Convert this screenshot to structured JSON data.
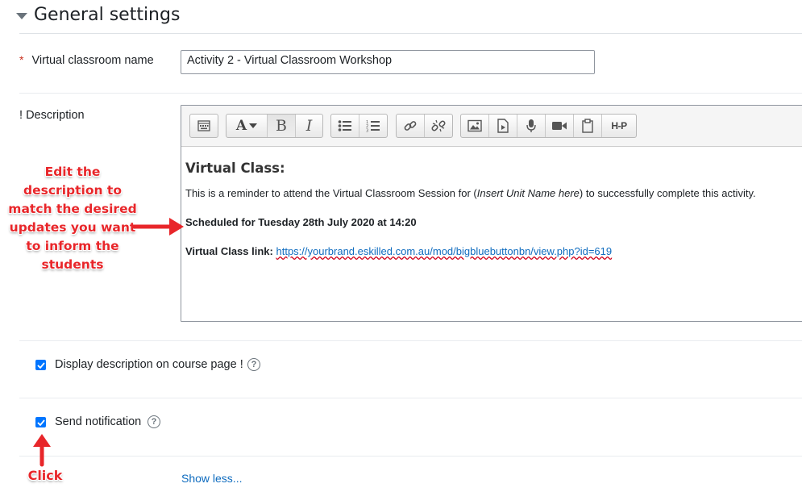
{
  "section": {
    "title": "General settings"
  },
  "fields": {
    "name": {
      "required_marker": "*",
      "label": "Virtual classroom name",
      "value": "Activity 2 - Virtual Classroom Workshop"
    },
    "description": {
      "label_prefix": "!",
      "label": "Description"
    }
  },
  "editor": {
    "heading": "Virtual Class:",
    "line1_before": "This is a reminder to attend the Virtual Classroom Session for (",
    "line1_italic": "Insert Unit Name here",
    "line1_after": ") to successfully complete this activity.",
    "scheduled": "Scheduled for Tuesday 28th July 2020 at 14:20",
    "link_label": "Virtual Class link:",
    "link_url": "https://yourbrand.eskilled.com.au/mod/bigbluebuttonbn/view.php?id=619",
    "toolbar": {
      "font_label": "A",
      "bold_label": "B",
      "italic_label": "I",
      "h5p_label": "H-P"
    }
  },
  "checkboxes": {
    "display_description": {
      "label": "Display description on course page",
      "suffix": "!",
      "checked": true
    },
    "send_notification": {
      "label": "Send notification",
      "checked": true
    }
  },
  "show_less": "Show less...",
  "annotations": {
    "edit_note": "Edit the description to match the desired updates you want to inform the students",
    "click_note": "Click"
  },
  "colors": {
    "accent": "#0f6cbf",
    "annotation": "#e8262a",
    "required": "#ca3120",
    "checkbox": "#0075ff"
  }
}
